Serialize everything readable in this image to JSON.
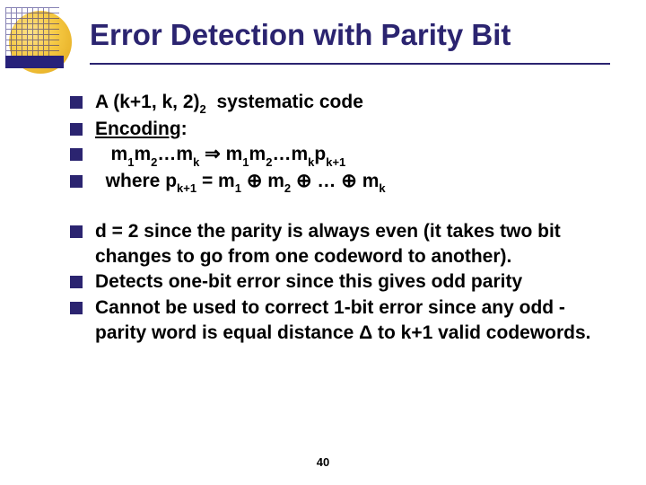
{
  "title": "Error Detection with Parity Bit",
  "bullets_a": [
    {
      "html": "A (k+1, k, 2)<span class='sub'>2</span>&nbsp; systematic code"
    },
    {
      "html": "<span class='u'>Encoding</span>:"
    },
    {
      "html": "&nbsp;&nbsp;&nbsp;m<span class='sub'>1</span>m<span class='sub'>2</span>…m<span class='sub'>k</span> &#8658; m<span class='sub'>1</span>m<span class='sub'>2</span>…m<span class='sub'>k</span>p<span class='sub'>k+1</span>"
    },
    {
      "html": "&nbsp;&nbsp;where p<span class='sub'>k+1</span> = m<span class='sub'>1</span> &oplus; m<span class='sub'>2</span> &oplus; … &oplus; m<span class='sub'>k</span>"
    }
  ],
  "bullets_b": [
    {
      "html": "d = 2 since the parity is always even (it takes two bit changes to go from one codeword to another)."
    },
    {
      "html": "Detects one-bit error since this gives odd parity"
    },
    {
      "html": "Cannot be used to correct 1-bit error since any odd -parity word is equal distance &Delta; to k+1 valid codewords."
    }
  ],
  "page_number": "40"
}
